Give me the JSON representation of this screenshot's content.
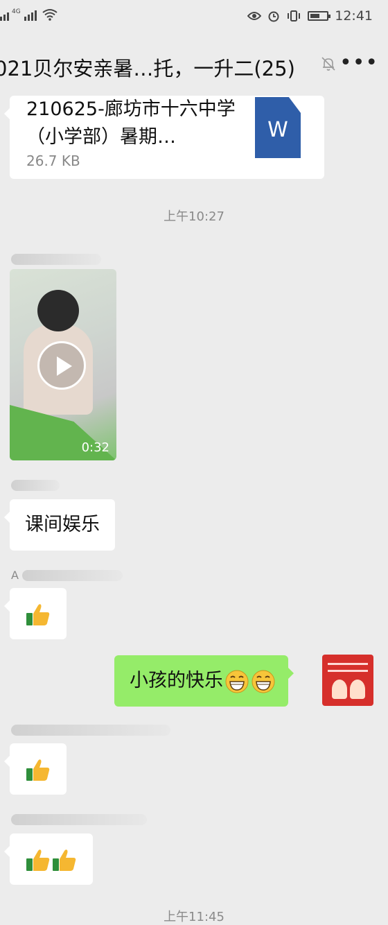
{
  "status_bar": {
    "network_label": "4G",
    "time": "12:41",
    "battery_level": 0.6
  },
  "chat": {
    "title": "021贝尔安亲暑…托，一升二(25)",
    "muted_icon": "bell-muted-icon",
    "more_icon": "more-dots-icon"
  },
  "messages": {
    "file": {
      "name": "210625-廊坊市十六中学（小学部）暑期…",
      "size": "26.7 KB",
      "icon": "word-doc-icon",
      "icon_letter": "W"
    },
    "time_1": "上午10:27",
    "video": {
      "duration": "0:32"
    },
    "text_1": "课间娱乐",
    "sender_a": "A",
    "own_text": "小孩的快乐",
    "time_2": "上午11:45"
  },
  "colors": {
    "background": "#ececec",
    "own_bubble": "#95ec69",
    "word_blue": "#2f5ea9"
  }
}
